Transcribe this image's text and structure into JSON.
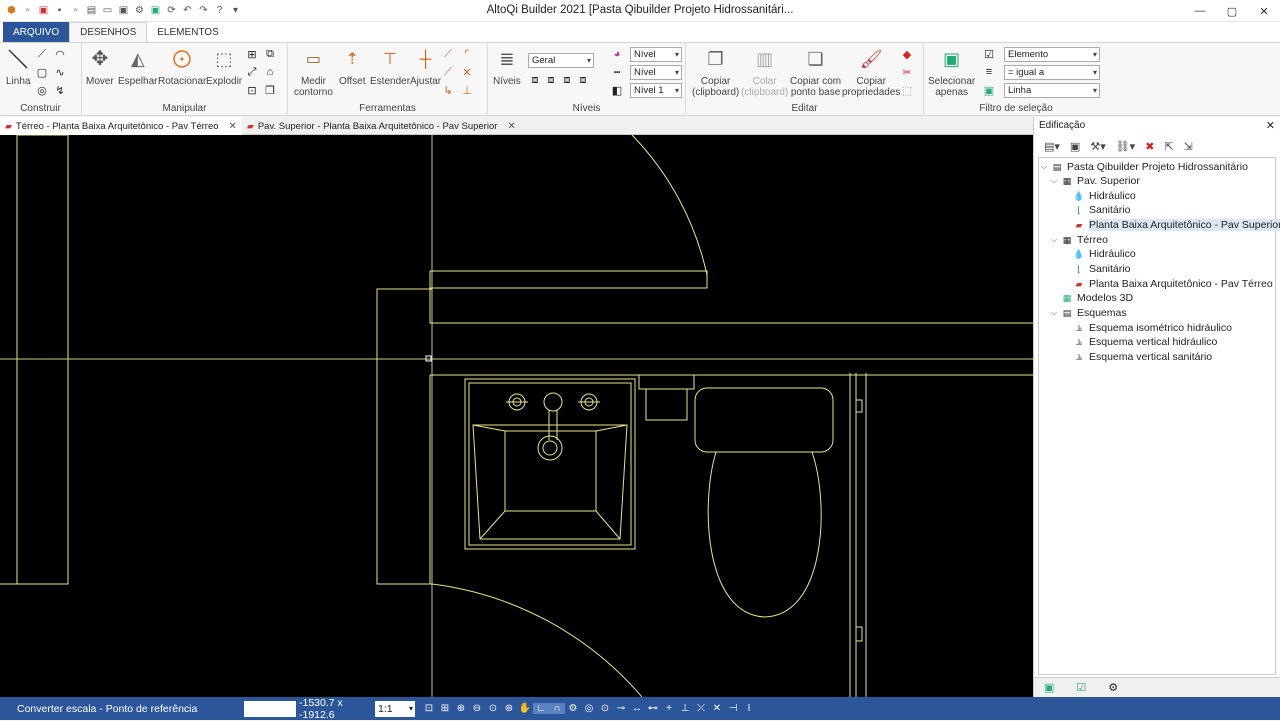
{
  "app": {
    "title": "AltoQi Builder 2021 [Pasta Qibuilder Projeto Hidrossanitári..."
  },
  "window_controls": [
    "—",
    "▢",
    "✕"
  ],
  "ribbon_tabs": [
    "ARQUIVO",
    "DESENHOS",
    "ELEMENTOS"
  ],
  "groups": {
    "construir": {
      "label": "Construir",
      "linha": "Linha"
    },
    "manipular": {
      "label": "Manipular",
      "mover": "Mover",
      "espelhar": "Espelhar",
      "rotacionar": "Rotacionar",
      "explodir": "Explodir"
    },
    "ferramentas": {
      "label": "Ferramentas",
      "medir1": "Medir",
      "medir2": "contorno",
      "offset": "Offset",
      "estender": "Estender",
      "ajustar": "Ajustar"
    },
    "niveis": {
      "label": "Níveis",
      "niveis_btn": "Níveis",
      "combo_geral": "Geral",
      "combo_nivel1": "Nível",
      "combo_nivel2": "Nível",
      "combo_nivel3": "Nível 1"
    },
    "editar": {
      "label": "Editar",
      "copiar1": "Copiar",
      "copiar2": "(clipboard)",
      "colar1": "Colar",
      "colar2": "(clipboard)",
      "cpb1": "Copiar com",
      "cpb2": "ponto base",
      "cprop1": "Copiar",
      "cprop2": "propriedades"
    },
    "filtro": {
      "label": "Filtro de seleção",
      "sel1": "Selecionar",
      "sel2": "apenas",
      "combo1": "Elemento",
      "combo2": "= igual a",
      "combo3": "Linha"
    }
  },
  "doc_tabs": [
    {
      "label": "Térreo - Planta Baixa Arquitetônico - Pav Térreo"
    },
    {
      "label": "Pav. Superior - Planta Baixa Arquitetônico - Pav Superior"
    }
  ],
  "panel": {
    "title": "Edificação",
    "tree": [
      {
        "label": "Pasta Qibuilder Projeto Hidrossanitário",
        "icon": "folder-icon"
      },
      {
        "label": "Pav. Superior",
        "icon": "floor-icon"
      },
      {
        "label": "Hidráulico",
        "icon": "drop-icon"
      },
      {
        "label": "Sanitário",
        "icon": "pipe-icon"
      },
      {
        "label": "Planta Baixa Arquitetônico - Pav Superior",
        "icon": "dwg-icon"
      },
      {
        "label": "Térreo",
        "icon": "floor-icon"
      },
      {
        "label": "Hidráulico",
        "icon": "drop-icon"
      },
      {
        "label": "Sanitário",
        "icon": "pipe-icon"
      },
      {
        "label": "Planta Baixa Arquitetônico - Pav Térreo",
        "icon": "dwg-icon"
      },
      {
        "label": "Modelos 3D",
        "icon": "model-icon"
      },
      {
        "label": "Esquemas",
        "icon": "scheme-icon"
      },
      {
        "label": "Esquema isométrico hidráulico",
        "icon": "scheme-item-icon"
      },
      {
        "label": "Esquema vertical hidráulico",
        "icon": "scheme-item-icon"
      },
      {
        "label": "Esquema vertical sanitário",
        "icon": "scheme-item-icon"
      }
    ]
  },
  "status": {
    "text": "Converter escala - Ponto de referência",
    "coords": "-1530.7 x -1912.6",
    "scale": "1:1"
  },
  "colors": {
    "accent": "#2b579a",
    "drawing_line": "#e6e68a",
    "canvas": "#000000"
  }
}
